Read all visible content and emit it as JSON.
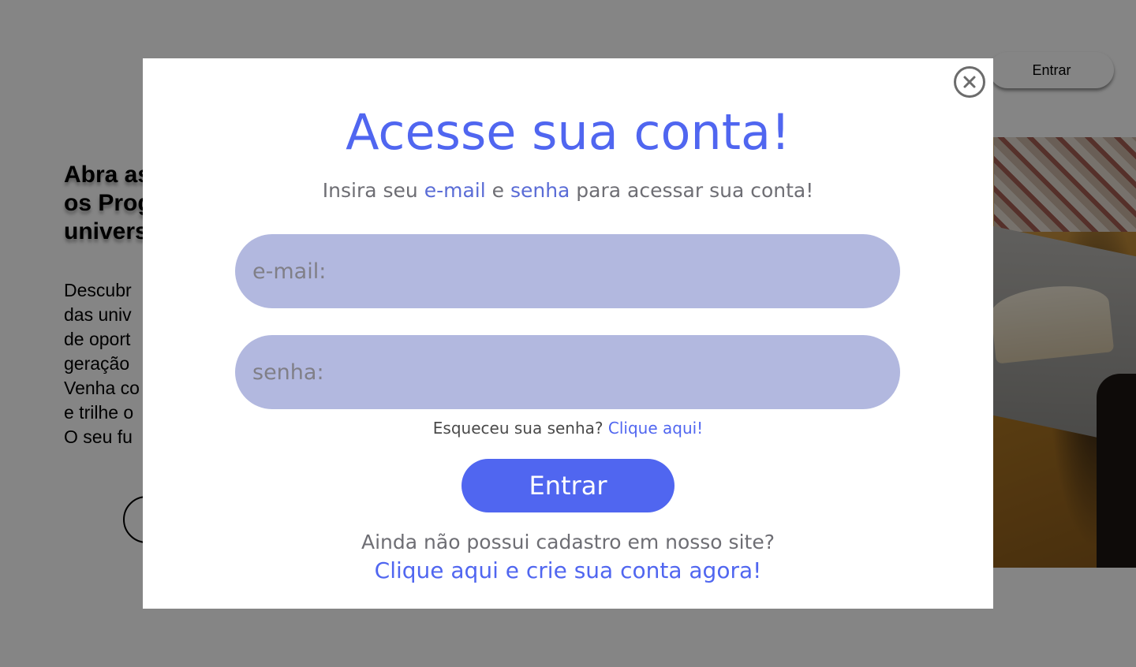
{
  "header": {
    "login_label": "Entrar"
  },
  "hero": {
    "title_lines": [
      "Abra as",
      "os Prog",
      "univers"
    ],
    "text_lines": [
      "Descubr",
      "das univ",
      "de oport",
      "geração",
      "Venha co",
      "e trilhe o",
      "O seu fu"
    ]
  },
  "modal": {
    "title": "Acesse sua conta!",
    "subtitle_prefix": "Insira seu ",
    "subtitle_email": "e-mail",
    "subtitle_mid": " e ",
    "subtitle_password": "senha",
    "subtitle_suffix": " para acessar sua conta!",
    "email_placeholder": "e-mail:",
    "password_placeholder": "senha:",
    "forgot_text": "Esqueceu sua senha? ",
    "forgot_link": "Clique aqui!",
    "submit_label": "Entrar",
    "signup_question": "Ainda não possui cadastro em nosso site?",
    "signup_link": "Clique aqui e crie sua conta agora!",
    "close_icon": "close-icon"
  },
  "colors": {
    "accent": "#5066f0",
    "field_bg": "#b2b8df",
    "overlay": "rgba(0,0,0,0.48)"
  }
}
